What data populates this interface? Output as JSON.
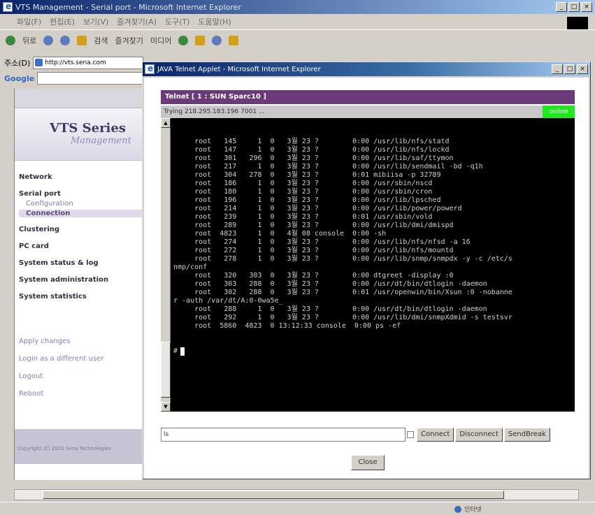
{
  "outer_window": {
    "title": "VTS Management - Serial port - Microsoft Internet Explorer",
    "menu": [
      "파일(F)",
      "편집(E)",
      "보기(V)",
      "즐겨찾기(A)",
      "도구(T)",
      "도움말(H)"
    ],
    "toolbar": [
      "뒤로",
      "검색",
      "즐겨찾기",
      "미디어"
    ],
    "address_label": "주소(D)",
    "address_value": "http://vts.sena.com",
    "google_label": "Google"
  },
  "background_page": {
    "brand_title": "VTS Series",
    "brand_subtitle": "Management",
    "nav": {
      "network": "Network",
      "serial_port": "Serial port",
      "configuration": "Configuration",
      "connection": "Connection",
      "clustering": "Clustering",
      "pc_card": "PC card",
      "system_status": "System status & log",
      "system_admin": "System administration",
      "system_stats": "System statistics"
    },
    "actions": {
      "apply": "Apply changes",
      "login": "Login as a different user",
      "logout": "Logout",
      "reboot": "Reboot"
    },
    "footer": "Copyright (C) 2003 Sena Technologies"
  },
  "popup": {
    "title": "JAVA Telnet Applet - Microsoft Internet Explorer",
    "telnet_header": "Telnet [ 1 : SUN Sparc10 ]",
    "trying": "Trying 218.295.183.196 7001 ...",
    "status": "online",
    "terminal_lines": [
      "     root   145     1  0   3월 23 ?        0:00 /usr/lib/nfs/statd",
      "     root   147     1  0   3월 23 ?        0:00 /usr/lib/nfs/lockd",
      "     root   301   296  0   3월 23 ?        0:00 /usr/lib/saf/ttymon",
      "     root   217     1  0   3월 23 ?        0:00 /usr/lib/sendmail -bd -q1h",
      "     root   304   278  0   3월 23 ?        0:01 mibiisa -p 32789",
      "     root   186     1  0   3월 23 ?        0:00 /usr/sbin/nscd",
      "     root   180     1  0   3월 23 ?        0:00 /usr/sbin/cron",
      "     root   196     1  0   3월 23 ?        0:00 /usr/lib/lpsched",
      "     root   214     1  0   3월 23 ?        0:00 /usr/lib/power/powerd",
      "     root   239     1  0   3월 23 ?        0:01 /usr/sbin/vold",
      "     root   289     1  0   3월 23 ?        0:00 /usr/lib/dmi/dmispd",
      "     root  4823     1  0   4월 08 console  0:00 -sh",
      "     root   274     1  0   3월 23 ?        0:00 /usr/lib/nfs/nfsd -a 16",
      "     root   272     1  0   3월 23 ?        0:00 /usr/lib/nfs/mountd",
      "     root   278     1  0   3월 23 ?        0:00 /usr/lib/snmp/snmpdx -y -c /etc/s",
      "nmp/conf",
      "     root   320   303  0   3월 23 ?        0:00 dtgreet -display :0",
      "     root   303   288  0   3월 23 ?        0:00 /usr/dt/bin/dtlogin -daemon",
      "     root   302   288  0   3월 23 ?        0:01 /usr/openwin/bin/Xsun :0 -nobanne",
      "r -auth /var/dt/A:0-0wa5e_",
      "     root   288     1  0   3월 23 ?        0:00 /usr/dt/bin/dtlogin -daemon",
      "     root   292     1  0   3월 23 ?        0:00 /usr/lib/dmi/snmpXdmid -s testsvr",
      "     root  5860  4823  0 13:12:33 console  0:00 ps -ef"
    ],
    "prompt": "#",
    "input_value": "ls",
    "connect": "Connect",
    "disconnect": "Disconnect",
    "send_break": "SendBreak",
    "close": "Close"
  },
  "status_bar": {
    "zone": "인터넷"
  }
}
